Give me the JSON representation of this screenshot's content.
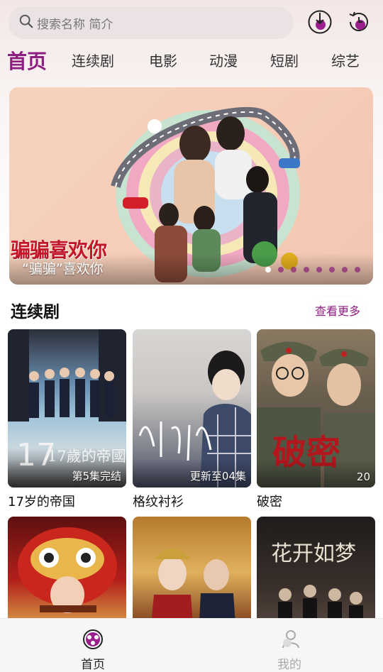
{
  "search": {
    "placeholder": "搜索名称 简介"
  },
  "header_icons": [
    "download-history-icon",
    "watch-history-icon"
  ],
  "tabs": [
    {
      "label": "首页",
      "active": true
    },
    {
      "label": "连续剧",
      "active": false
    },
    {
      "label": "电影",
      "active": false
    },
    {
      "label": "动漫",
      "active": false
    },
    {
      "label": "短剧",
      "active": false
    },
    {
      "label": "综艺",
      "active": false
    }
  ],
  "banner": {
    "title_art": "骗骗喜欢你",
    "caption": "“骗骗”喜欢你",
    "page_count": 8,
    "active_index": 0
  },
  "section": {
    "title": "连续剧",
    "more_label": "查看更多"
  },
  "cards": [
    {
      "title": "17岁的帝国",
      "badge": "第5集完结",
      "poster_text": "17歲的帝國"
    },
    {
      "title": "格纹衬衫",
      "badge": "更新至04集",
      "poster_text": ""
    },
    {
      "title": "破密",
      "badge": "20",
      "poster_text": "破密"
    },
    {
      "title": "",
      "badge": "",
      "poster_text": ""
    },
    {
      "title": "",
      "badge": "",
      "poster_text": ""
    },
    {
      "title": "",
      "badge": "",
      "poster_text": "花开如梦"
    }
  ],
  "bottom_nav": [
    {
      "label": "首页",
      "active": true
    },
    {
      "label": "我的",
      "active": false
    }
  ],
  "colors": {
    "accent": "#8e1f81",
    "banner_bg": "#f4d3bd"
  }
}
